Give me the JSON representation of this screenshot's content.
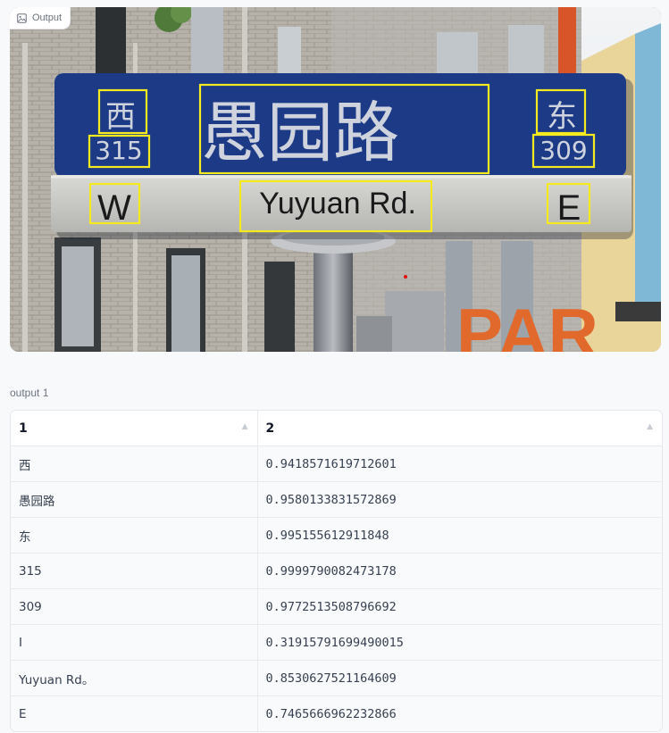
{
  "output": {
    "label": "Output",
    "sign": {
      "chinese_name": "愚园路",
      "west_char": "西",
      "west_number": "315",
      "east_char": "东",
      "east_number": "309",
      "west_letter": "W",
      "english_name": "Yuyuan Rd.",
      "east_letter": "E",
      "background_letters": "PAR"
    },
    "box_color": "#f5ea1f"
  },
  "table": {
    "caption": "output 1",
    "headers": [
      "1",
      "2"
    ],
    "rows": [
      [
        "西",
        "0.9418571619712601"
      ],
      [
        "愚园路",
        "0.9580133831572869"
      ],
      [
        "东",
        "0.995155612911848"
      ],
      [
        "315",
        "0.9999790082473178"
      ],
      [
        "309",
        "0.9772513508796692"
      ],
      [
        "I",
        "0.31915791699490015"
      ],
      [
        "Yuyuan Rd。",
        "0.8530627521164609"
      ],
      [
        "E",
        "0.7465666962232866"
      ]
    ]
  }
}
